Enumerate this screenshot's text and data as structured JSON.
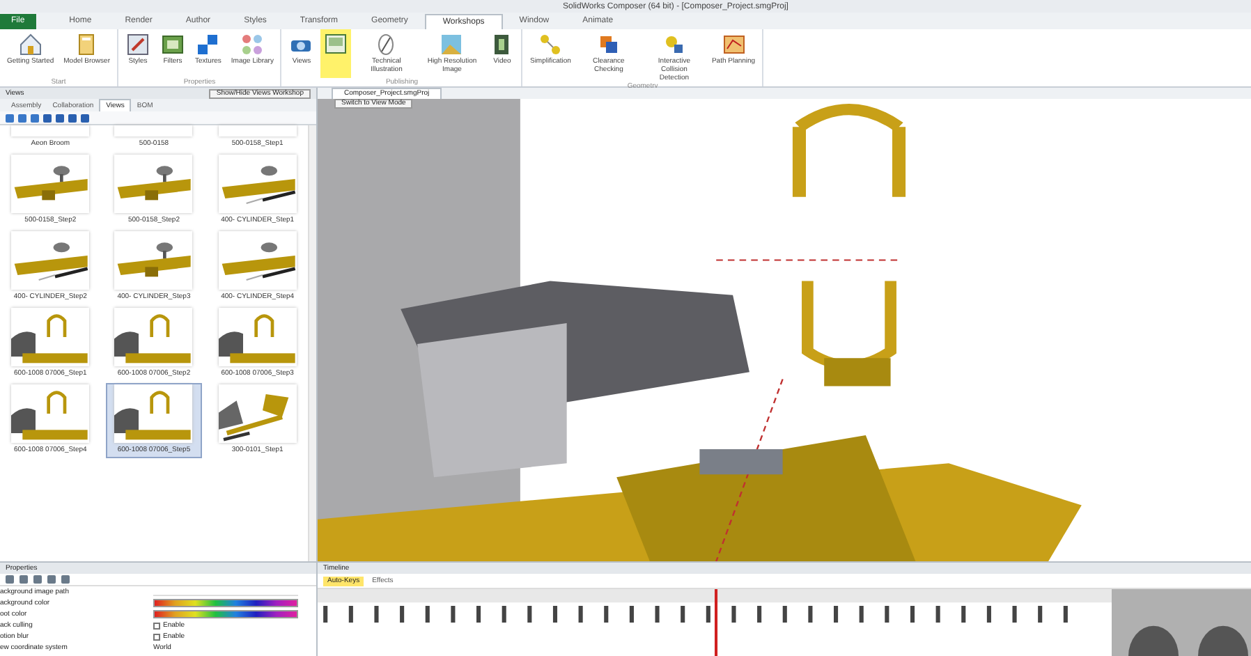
{
  "window": {
    "title": "SolidWorks Composer (64 bit) - [Composer_Project.smgProj]"
  },
  "menu_tabs": [
    {
      "label": "File",
      "kind": "file",
      "selected": false
    },
    {
      "label": "Home",
      "kind": "tab",
      "selected": false
    },
    {
      "label": "Render",
      "kind": "tab",
      "selected": false
    },
    {
      "label": "Author",
      "kind": "tab",
      "selected": false
    },
    {
      "label": "Styles",
      "kind": "tab",
      "selected": false
    },
    {
      "label": "Transform",
      "kind": "tab",
      "selected": false
    },
    {
      "label": "Geometry",
      "kind": "tab",
      "selected": false
    },
    {
      "label": "Workshops",
      "kind": "tab",
      "selected": true
    },
    {
      "label": "Window",
      "kind": "tab",
      "selected": false
    },
    {
      "label": "Animate",
      "kind": "tab",
      "selected": false
    }
  ],
  "ribbon_groups": [
    {
      "label": "Start",
      "buttons": [
        {
          "label": "Getting Started",
          "selected": false
        },
        {
          "label": "Model Browser",
          "selected": false
        }
      ]
    },
    {
      "label": "Properties",
      "buttons": [
        {
          "label": "Styles",
          "selected": false
        },
        {
          "label": "Filters",
          "selected": false
        },
        {
          "label": "Textures",
          "selected": false
        },
        {
          "label": "Image Library",
          "selected": false
        }
      ]
    },
    {
      "label": "Publishing",
      "buttons": [
        {
          "label": "Views",
          "selected": false
        },
        {
          "selected": true
        },
        {
          "label": "Technical Illustration",
          "selected": false
        },
        {
          "label": "High Resolution Image",
          "selected": false
        },
        {
          "label": "Video",
          "selected": false
        }
      ]
    },
    {
      "label": "Geometry",
      "buttons": [
        {
          "label": "Simplification",
          "selected": false
        },
        {
          "label": "Clearance Checking",
          "selected": false
        },
        {
          "label": "Interactive Collision Detection",
          "selected": false
        },
        {
          "label": "Path Planning",
          "selected": false
        }
      ]
    }
  ],
  "tooltips": [
    {
      "text": "Show/Hide Views Workshop"
    },
    {
      "text": "Switch to View Mode"
    }
  ],
  "views_panel": {
    "title": "Views",
    "tabs": [
      {
        "label": "Assembly",
        "selected": false
      },
      {
        "label": "Collaboration",
        "selected": false
      },
      {
        "label": "Views",
        "selected": true
      },
      {
        "label": "BOM",
        "selected": false
      }
    ],
    "thumbnails": [
      {
        "label": "Aeon Broom",
        "kind": "top",
        "selected": false
      },
      {
        "label": "500-0158",
        "kind": "top",
        "selected": false
      },
      {
        "label": "500-0158_Step1",
        "kind": "top",
        "selected": false
      },
      {
        "label": "500-0158_Step2",
        "kind": "boom",
        "selected": false
      },
      {
        "label": "500-0158_Step2",
        "kind": "boom",
        "selected": false
      },
      {
        "label": "400- CYLINDER_Step1",
        "kind": "cylinder",
        "selected": false
      },
      {
        "label": "400- CYLINDER_Step2",
        "kind": "cylinder",
        "selected": false
      },
      {
        "label": "400- CYLINDER_Step3",
        "kind": "boom",
        "selected": false
      },
      {
        "label": "400- CYLINDER_Step4",
        "kind": "cylinder",
        "selected": false
      },
      {
        "label": "600-1008 07006_Step1",
        "kind": "handle",
        "selected": false
      },
      {
        "label": "600-1008 07006_Step2",
        "kind": "handle",
        "selected": false
      },
      {
        "label": "600-1008 07006_Step3",
        "kind": "handle",
        "selected": false
      },
      {
        "label": "600-1008 07006_Step4",
        "kind": "handle",
        "selected": false
      },
      {
        "label": "600-1008 07006_Step5",
        "kind": "handle",
        "selected": true
      },
      {
        "label": "300-0101_Step1",
        "kind": "exploded",
        "selected": false
      }
    ]
  },
  "document_tab": {
    "label": "Composer_Project.smgProj"
  },
  "properties_panel": {
    "title": "Properties",
    "rows": [
      {
        "label": "ackground image path",
        "kind": "text"
      },
      {
        "label": "ackground color",
        "kind": "gradient"
      },
      {
        "label": "oot color",
        "kind": "gradient"
      },
      {
        "label": "ack culling",
        "kind": "checkbox",
        "value": "Enable",
        "checked": false
      },
      {
        "label": "otion blur",
        "kind": "checkbox",
        "value": "Enable",
        "checked": false
      },
      {
        "label": "ew coordinate system",
        "kind": "select",
        "value": "World"
      }
    ]
  },
  "timeline": {
    "title": "Timeline",
    "auto_keys": "Auto-Keys",
    "effects": "Effects"
  }
}
